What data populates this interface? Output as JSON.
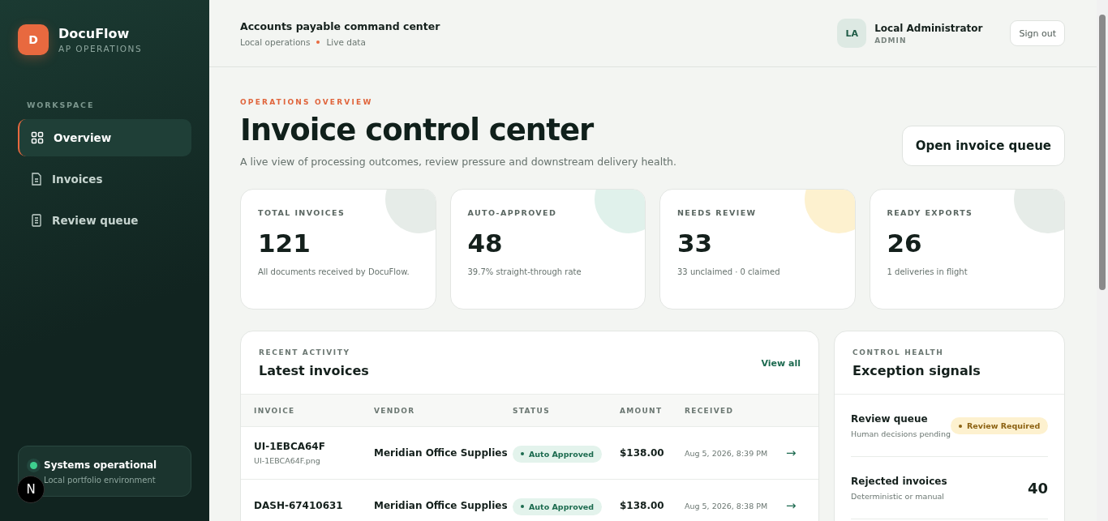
{
  "sidebar": {
    "logo_letter": "D",
    "brand": "DocuFlow",
    "subtitle": "AP OPERATIONS",
    "section": "WORKSPACE",
    "items": [
      {
        "label": "Overview",
        "kind": "grid",
        "selected": true
      },
      {
        "label": "Invoices",
        "kind": "doc",
        "selected": false
      },
      {
        "label": "Review queue",
        "kind": "list",
        "selected": false
      }
    ],
    "status": {
      "title": "Systems operational",
      "subtitle": "Local portfolio environment",
      "color": "#3ecf8e"
    },
    "dev_badge": "N"
  },
  "header": {
    "title": "Accounts payable command center",
    "meta": [
      "Local operations",
      "Live data"
    ],
    "user": {
      "initials": "LA",
      "name": "Local Administrator",
      "role": "ADMIN"
    },
    "sign_out": "Sign out"
  },
  "hero": {
    "eyebrow": "OPERATIONS OVERVIEW",
    "title": "Invoice control center",
    "description": "A live view of processing outcomes, review pressure and downstream delivery health.",
    "action": "Open invoice queue"
  },
  "stats": [
    {
      "label": "TOTAL INVOICES",
      "value": "121",
      "note": "All documents received by DocuFlow.",
      "color": "#e6ece8"
    },
    {
      "label": "AUTO-APPROVED",
      "value": "48",
      "note": "39.7% straight-through rate",
      "color": "#e0f1eb"
    },
    {
      "label": "NEEDS REVIEW",
      "value": "33",
      "note": "33 unclaimed · 0 claimed",
      "color": "#fdf1cf"
    },
    {
      "label": "READY EXPORTS",
      "value": "26",
      "note": "1 deliveries in flight",
      "color": "#e6ece8"
    }
  ],
  "latest": {
    "eyebrow": "RECENT ACTIVITY",
    "title": "Latest invoices",
    "link": "View all",
    "columns": [
      "INVOICE",
      "VENDOR",
      "STATUS",
      "AMOUNT",
      "RECEIVED"
    ],
    "rows": [
      {
        "invoice": "UI-1EBCA64F",
        "file": "UI-1EBCA64F.png",
        "vendor": "Meridian Office Supplies",
        "status": "Auto Approved",
        "kind": "approved",
        "amount": "$138.00",
        "received": "Aug 5, 2026, 8:39 PM",
        "arrow": "→"
      },
      {
        "invoice": "DASH-67410631",
        "vendor": "Meridian Office Supplies",
        "status": "Auto Approved",
        "kind": "approved",
        "amount": "$138.00",
        "received": "Aug 5, 2026, 8:38 PM",
        "arrow": "→"
      }
    ]
  },
  "health": {
    "eyebrow": "CONTROL HEALTH",
    "title": "Exception signals",
    "signals": [
      {
        "kind": "badge",
        "title": "Review queue",
        "subtitle": "Human decisions pending",
        "badge": "Review Required"
      },
      {
        "kind": "count",
        "title": "Rejected invoices",
        "subtitle": "Deterministic or manual",
        "count": "40"
      }
    ]
  }
}
